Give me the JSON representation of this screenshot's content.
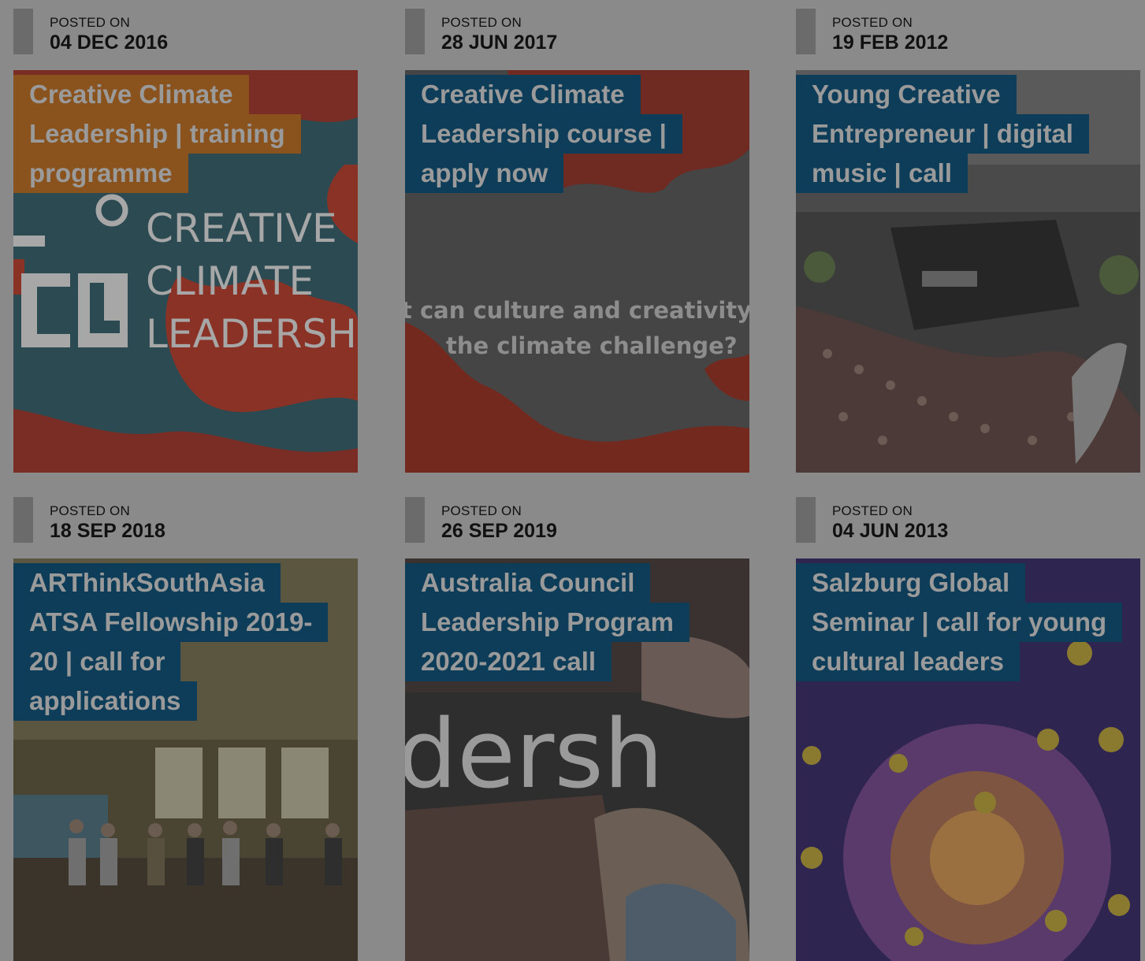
{
  "posted_on_label": "POSTED ON",
  "colors": {
    "title_blue": "#0e3d59",
    "title_orange": "#8a531e",
    "overlay": "#8a8a8a"
  },
  "posts": [
    {
      "date": "04 DEC 2016",
      "title_lines": [
        "Creative Climate",
        "Leadership | training",
        "programme"
      ],
      "image_text": [
        "CREATIVE",
        "CLIMATE",
        "LEADERSHI"
      ]
    },
    {
      "date": "28 JUN 2017",
      "title_lines": [
        "Creative Climate",
        "Leadership course |",
        "apply now"
      ],
      "image_text": [
        "t can culture and creativity",
        "the climate challenge?"
      ]
    },
    {
      "date": "19 FEB 2012",
      "title_lines": [
        "Young Creative",
        "Entrepreneur | digital",
        "music | call"
      ]
    },
    {
      "date": "18 SEP 2018",
      "title_lines": [
        "ARThinkSouthAsia",
        "ATSA Fellowship 2019-",
        "20 | call for",
        "applications"
      ]
    },
    {
      "date": "26 SEP 2019",
      "title_lines": [
        "Australia Council",
        "Leadership Program",
        "2020-2021 call"
      ],
      "image_text": [
        "dersh"
      ]
    },
    {
      "date": "04 JUN 2013",
      "title_lines": [
        "Salzburg Global",
        "Seminar | call for young",
        "cultural leaders"
      ]
    }
  ]
}
